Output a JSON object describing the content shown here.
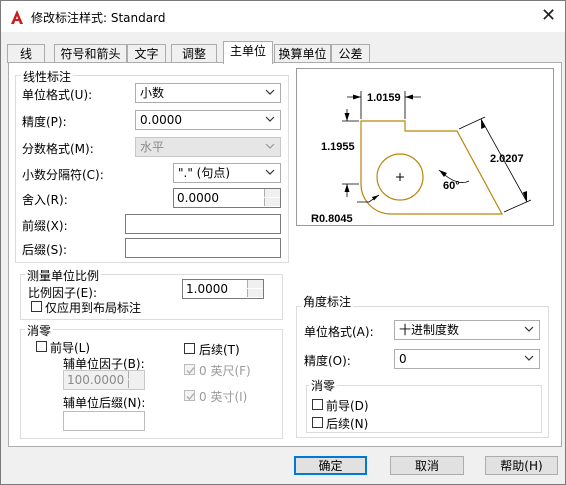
{
  "window": {
    "title": "修改标注样式: Standard",
    "close_glyph": "✕"
  },
  "tabs": [
    {
      "label": "线"
    },
    {
      "label": "符号和箭头"
    },
    {
      "label": "文字"
    },
    {
      "label": "调整"
    },
    {
      "label": "主单位",
      "active": true
    },
    {
      "label": "换算单位"
    },
    {
      "label": "公差"
    }
  ],
  "linear": {
    "title": "线性标注",
    "unit_format_label": "单位格式(U):",
    "unit_format_value": "小数",
    "precision_label": "精度(P):",
    "precision_value": "0.0000",
    "fraction_format_label": "分数格式(M):",
    "fraction_format_value": "水平",
    "decimal_sep_label": "小数分隔符(C):",
    "decimal_sep_value": "\".\" (句点)",
    "round_off_label": "舍入(R):",
    "round_off_value": "0.0000",
    "prefix_label": "前缀(X):",
    "prefix_value": "",
    "suffix_label": "后缀(S):",
    "suffix_value": ""
  },
  "scale": {
    "title": "测量单位比例",
    "factor_label": "比例因子(E):",
    "factor_value": "1.0000",
    "layout_only_label": "仅应用到布局标注"
  },
  "zero_suppress": {
    "title": "消零",
    "leading_label": "前导(L)",
    "sub_factor_label": "辅单位因子(B):",
    "sub_factor_value": "100.0000",
    "sub_suffix_label": "辅单位后缀(N):",
    "sub_suffix_value": "",
    "trailing_label": "后续(T)",
    "feet_label": "0 英尺(F)",
    "inches_label": "0 英寸(I)"
  },
  "preview": {
    "dim_top": "1.0159",
    "dim_left": "1.1955",
    "dim_right": "2.0207",
    "dim_angle": "60°",
    "dim_radius": "R0.8045",
    "stroke_color": "#000000",
    "shape_color": "#b8860b"
  },
  "angular": {
    "title": "角度标注",
    "unit_format_label": "单位格式(A):",
    "unit_format_value": "十进制度数",
    "precision_label": "精度(O):",
    "precision_value": "0",
    "zero_title": "消零",
    "leading_label": "前导(D)",
    "trailing_label": "后续(N)"
  },
  "buttons": {
    "ok": "确定",
    "cancel": "取消",
    "help": "帮助(H)"
  },
  "colors": {
    "accent": "#0078d7",
    "app_icon": "#c81e1e"
  }
}
